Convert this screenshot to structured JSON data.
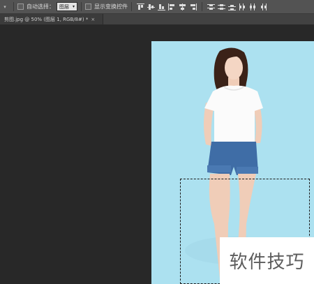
{
  "options": {
    "auto_select_label": "自动选择：",
    "auto_select_value": "图层",
    "show_transform_label": "显示变换控件"
  },
  "document": {
    "tab_title": "剪图.jpg @ 50% (图层 1, RGB/8#) *"
  },
  "watermark": "软件技巧",
  "icons": [
    "chevron-down-icon",
    "align-top-icon",
    "align-vcenter-icon",
    "align-bottom-icon",
    "align-left-icon",
    "align-hcenter-icon",
    "align-right-icon",
    "distribute-top-icon",
    "distribute-vcenter-icon",
    "distribute-bottom-icon",
    "distribute-left-icon",
    "distribute-hcenter-icon",
    "distribute-right-icon",
    "close-icon"
  ]
}
